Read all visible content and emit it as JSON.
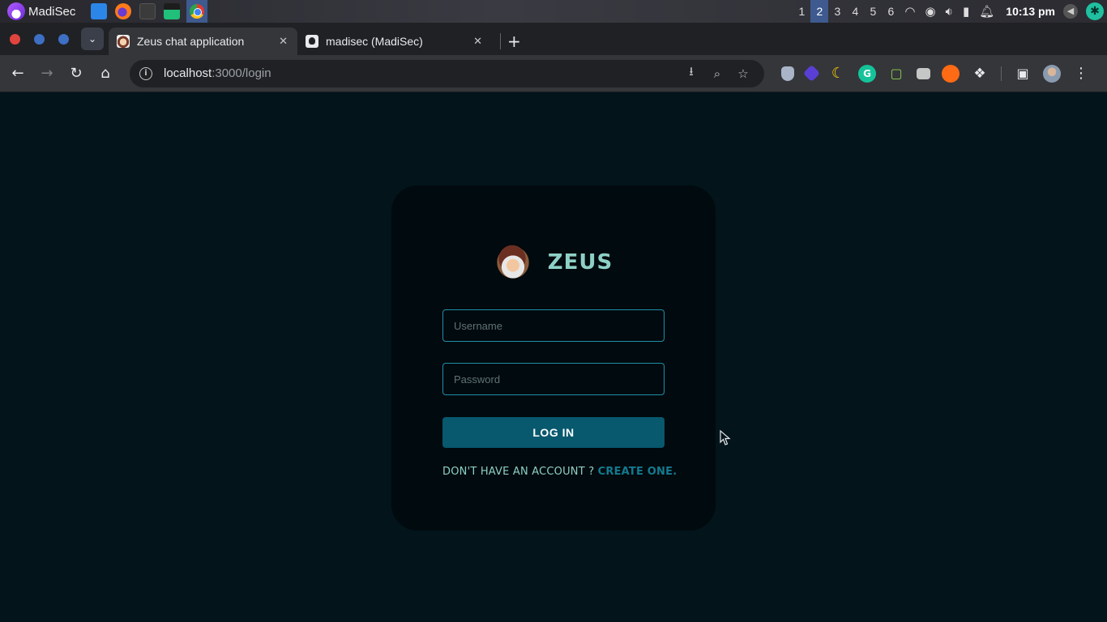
{
  "os_panel": {
    "user_label": "MadiSec",
    "workspaces": [
      "1",
      "2",
      "3",
      "4",
      "5",
      "6"
    ],
    "active_workspace": "2",
    "clock": "10:13 pm"
  },
  "browser": {
    "tabs": [
      {
        "title": "Zeus chat application",
        "active": true,
        "close": "✕"
      },
      {
        "title": "madisec (MadiSec)",
        "active": false,
        "close": "✕"
      }
    ],
    "new_tab": "+",
    "url_host": "localhost",
    "url_path": ":3000/login"
  },
  "login": {
    "brand_name": "ZEUS",
    "username_placeholder": "Username",
    "password_placeholder": "Password",
    "login_label": "LOG IN",
    "signup_prompt": "DON'T HAVE AN ACCOUNT ? ",
    "signup_link": "CREATE ONE."
  },
  "colors": {
    "page_background": "#03141b",
    "card_background": "#010a0e",
    "accent_teal": "#8ed0c6",
    "button": "#08586e",
    "link": "#137a90",
    "input_border": "#1f8fa8"
  },
  "icons": {
    "toolbar": [
      "back-icon",
      "forward-icon",
      "reload-icon",
      "home-icon",
      "site-info-icon",
      "install-app-icon",
      "zoom-icon",
      "bookmark-star-icon"
    ],
    "extensions": [
      "shield-extension-icon",
      "layers-extension-icon",
      "moon-extension-icon",
      "grammarly-extension-icon",
      "chat-extension-icon",
      "video-extension-icon",
      "orange-extension-icon",
      "puzzle-extensions-icon",
      "side-panel-icon",
      "profile-avatar",
      "menu-dots-icon"
    ]
  }
}
